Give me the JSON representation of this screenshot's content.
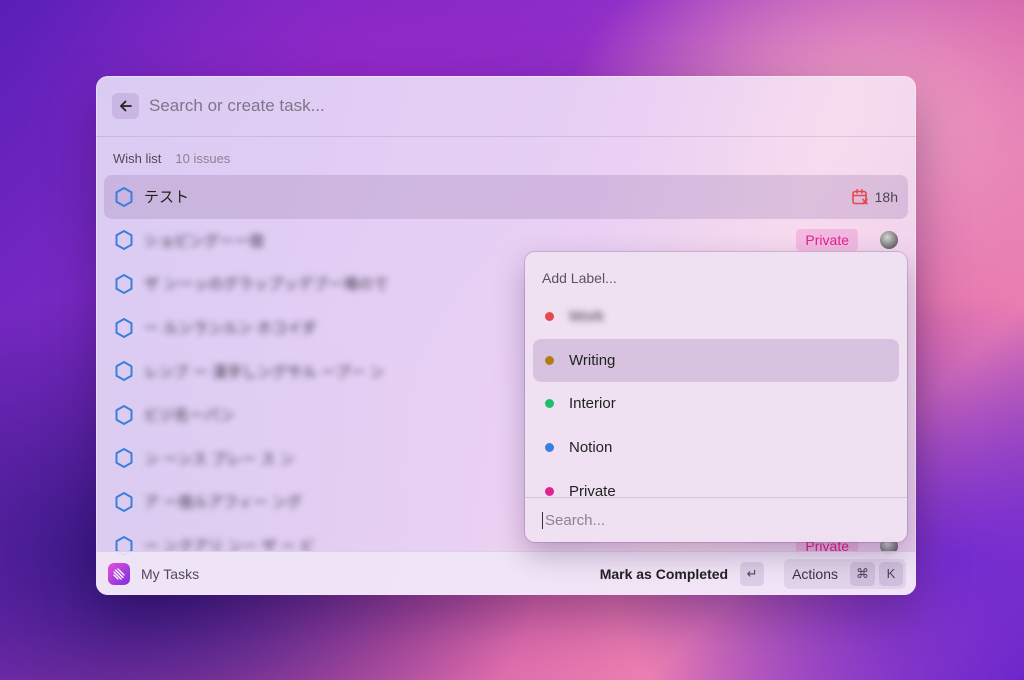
{
  "search": {
    "placeholder": "Search or create task..."
  },
  "section": {
    "title": "Wish list",
    "count": "10 issues"
  },
  "tasks": [
    {
      "title": "テスト",
      "due": "18h",
      "badge": "",
      "blurred": false
    },
    {
      "title": "ショピングーー宿",
      "due": "",
      "badge": "Private",
      "blurred": true
    },
    {
      "title": "ザ ンーッのグラップッデブー場ので",
      "due": "",
      "badge": "",
      "blurred": true
    },
    {
      "title": "ー ルンランルン ホコイダ",
      "due": "",
      "badge": "",
      "blurred": true
    },
    {
      "title": "レンブ ー 漢字しングサル ープー ン",
      "due": "",
      "badge": "",
      "blurred": true
    },
    {
      "title": "ビジ名ーパン",
      "due": "",
      "badge": "",
      "blurred": true
    },
    {
      "title": "ン ーンス  ブレー   ス ン",
      "due": "",
      "badge": "",
      "blurred": true
    },
    {
      "title": "ア ー宿ルアフィー ング",
      "due": "",
      "badge": "",
      "blurred": true
    },
    {
      "title": "ー ンクアリ ンー  ザ ー ビ",
      "due": "",
      "badge": "Private",
      "blurred": true
    }
  ],
  "label_popover": {
    "title": "Add Label...",
    "items": [
      {
        "label": "Work",
        "color": "#e5484d",
        "blurred": true
      },
      {
        "label": "Writing",
        "color": "#b07d16",
        "blurred": false
      },
      {
        "label": "Interior",
        "color": "#1fbf6a",
        "blurred": false
      },
      {
        "label": "Notion",
        "color": "#3b7fdc",
        "blurred": false
      },
      {
        "label": "Private",
        "color": "#e0238f",
        "blurred": false
      }
    ],
    "search_placeholder": "Search..."
  },
  "footer": {
    "app_name": "My Tasks",
    "primary_action": "Mark as Completed",
    "primary_shortcut": "↵",
    "actions_label": "Actions",
    "actions_shortcut": [
      "⌘",
      "K"
    ]
  },
  "colors": {
    "accent_hex": "#3b7fdc",
    "private_badge": "#e0238f",
    "due_icon": "#e5484d"
  }
}
